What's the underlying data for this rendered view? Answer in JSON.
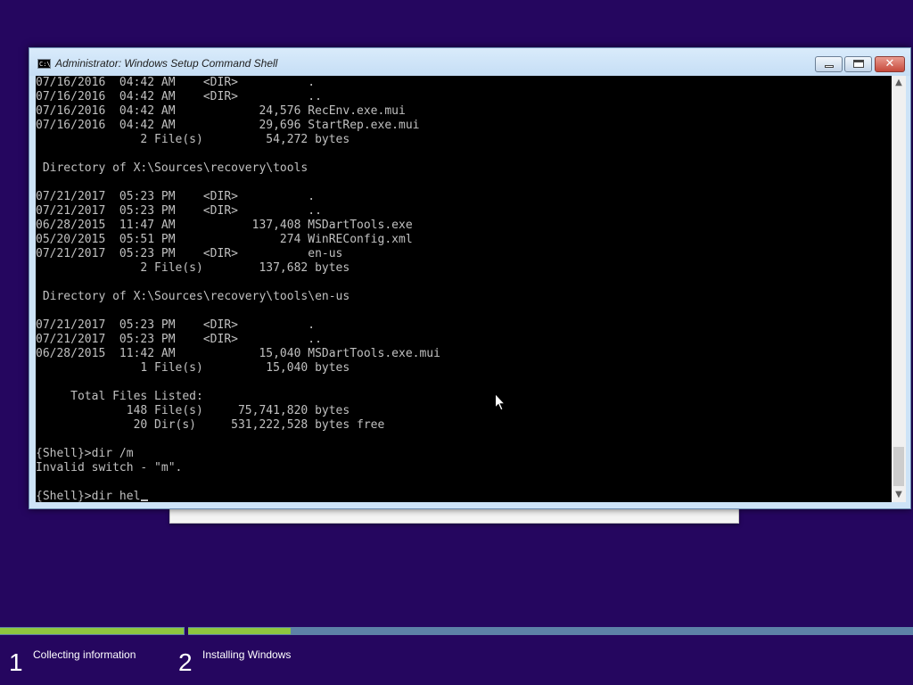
{
  "window": {
    "title": "Administrator: Windows Setup Command Shell",
    "icon_text": "C:\\",
    "close_glyph": "✕"
  },
  "console": {
    "lines": [
      "07/16/2016  04:42 AM    <DIR>          .",
      "07/16/2016  04:42 AM    <DIR>          ..",
      "07/16/2016  04:42 AM            24,576 RecEnv.exe.mui",
      "07/16/2016  04:42 AM            29,696 StartRep.exe.mui",
      "               2 File(s)         54,272 bytes",
      "",
      " Directory of X:\\Sources\\recovery\\tools",
      "",
      "07/21/2017  05:23 PM    <DIR>          .",
      "07/21/2017  05:23 PM    <DIR>          ..",
      "06/28/2015  11:47 AM           137,408 MSDartTools.exe",
      "05/20/2015  05:51 PM               274 WinREConfig.xml",
      "07/21/2017  05:23 PM    <DIR>          en-us",
      "               2 File(s)        137,682 bytes",
      "",
      " Directory of X:\\Sources\\recovery\\tools\\en-us",
      "",
      "07/21/2017  05:23 PM    <DIR>          .",
      "07/21/2017  05:23 PM    <DIR>          ..",
      "06/28/2015  11:42 AM            15,040 MSDartTools.exe.mui",
      "               1 File(s)         15,040 bytes",
      "",
      "     Total Files Listed:",
      "             148 File(s)     75,741,820 bytes",
      "              20 Dir(s)     531,222,528 bytes free",
      "",
      "{Shell}>dir /m",
      "Invalid switch - \"m\".",
      ""
    ],
    "current_input": "{Shell}>dir hel"
  },
  "scrollbar": {
    "up_glyph": "▲",
    "down_glyph": "▼"
  },
  "setup_steps": {
    "step1": {
      "number": "1",
      "label": "Collecting information"
    },
    "step2": {
      "number": "2",
      "label": "Installing Windows"
    }
  },
  "colors": {
    "background": "#25065f",
    "progress_fill": "#8dc63f",
    "progress_track": "#5d81a7",
    "console_text": "#c0c0c0"
  }
}
